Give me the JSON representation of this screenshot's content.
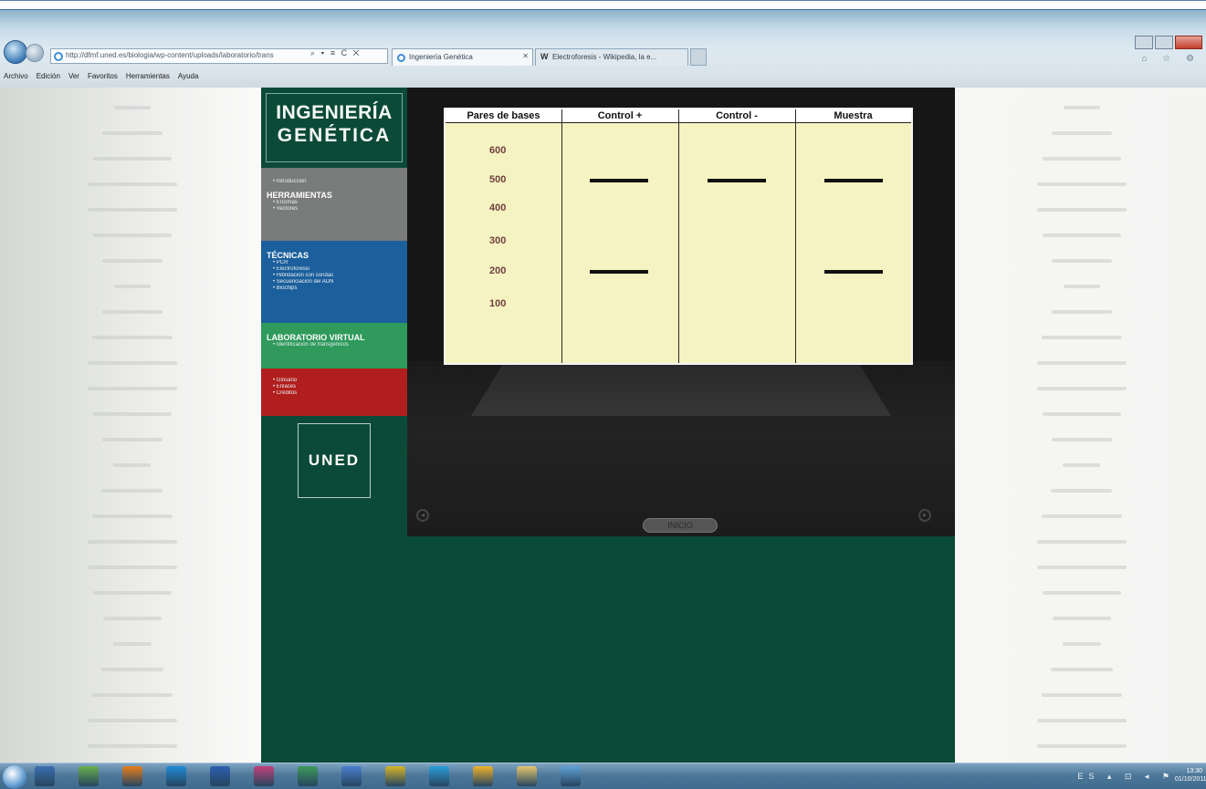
{
  "browser": {
    "address": "http://dfmf.uned.es/biologia/wp-content/uploads/laboratorio/trans",
    "address_tools": "⌕ ▾ ≡ C ✕",
    "tabs": [
      {
        "label": "Ingeniería Genética"
      },
      {
        "label": "Electroforesis - Wikipedia, la e..."
      }
    ],
    "menu": [
      "Archivo",
      "Edición",
      "Ver",
      "Favoritos",
      "Herramientas",
      "Ayuda"
    ]
  },
  "site": {
    "logo_line1": "INGENIERÍA",
    "logo_line2": "GENÉTICA",
    "menu": {
      "intro_item": "Introducción",
      "tools": {
        "title": "HERRAMIENTAS",
        "items": [
          "Enzimas",
          "Vectores"
        ]
      },
      "techniques": {
        "title": "TÉCNICAS",
        "items": [
          "PCR",
          "Electroforesis",
          "Hibridación con sondas",
          "Secuenciación del ADN",
          "Biochips"
        ]
      },
      "lab": {
        "title": "LABORATORIO VIRTUAL",
        "items": [
          "Identificación de transgénicos"
        ]
      },
      "misc": {
        "items": [
          "Glosario",
          "Enlaces",
          "Créditos"
        ]
      }
    },
    "uned": "UNED"
  },
  "lab": {
    "inicio": "INICIO",
    "gel": {
      "columns": [
        "Pares de bases",
        "Control +",
        "Control -",
        "Muestra"
      ],
      "base_pairs": [
        "600",
        "500",
        "400",
        "300",
        "200",
        "100"
      ],
      "bands": {
        "control_positive": [
          "500",
          "200"
        ],
        "control_negative": [
          "500"
        ],
        "sample": [
          "500",
          "200"
        ]
      }
    }
  },
  "taskbar": {
    "tray": "ES ▴ ⊡ ◂ ⚑",
    "time": "13:30",
    "date": "01/10/2011"
  },
  "colors": {
    "site_bg": "#0c4a38",
    "tools_bg": "#7a7c7b",
    "techniques_bg": "#1b5f9c",
    "lab_bg": "#2f9a5c",
    "misc_bg": "#b01f1e",
    "gel_bg": "#f5f3c1"
  }
}
